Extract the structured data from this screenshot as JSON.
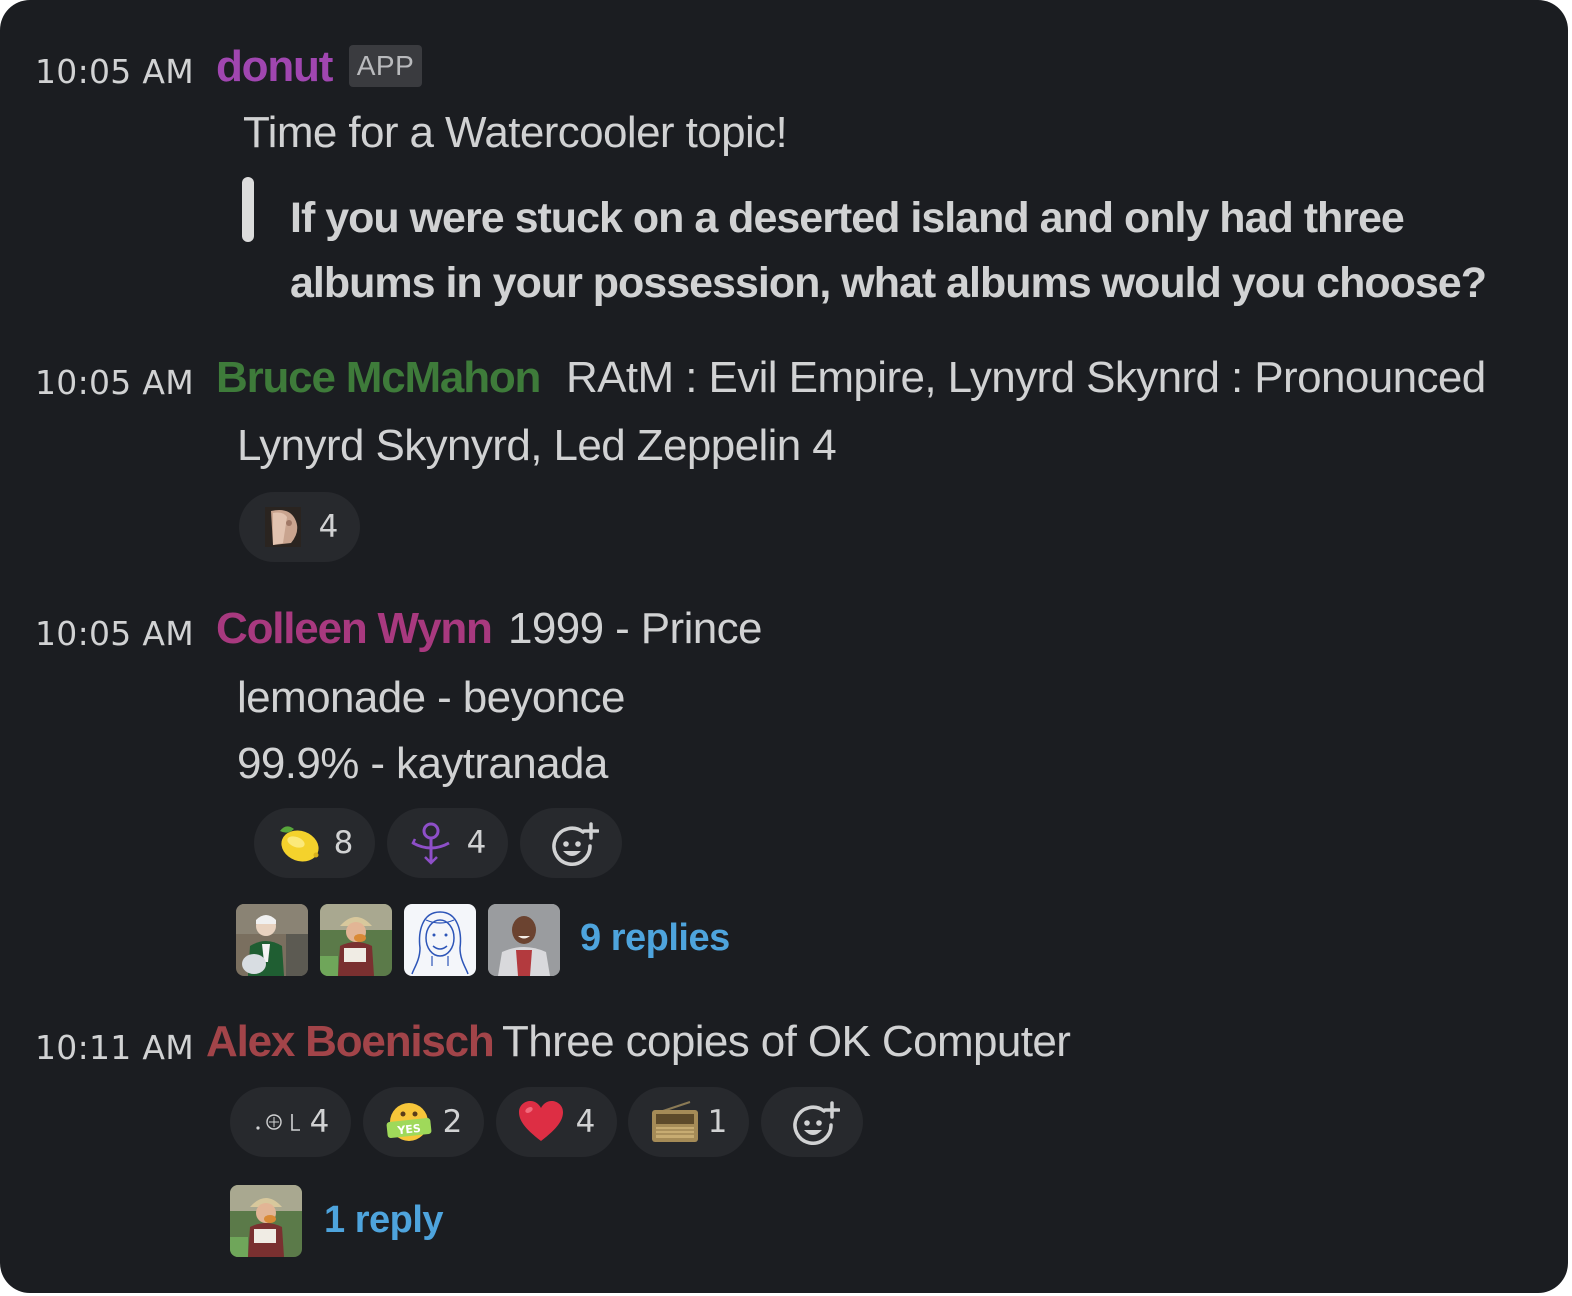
{
  "colors": {
    "background": "#1b1d21",
    "text": "#d1d2d3",
    "donut_name": "#a046b0",
    "bruce_name": "#3e7b3a",
    "colleen_name": "#a8397f",
    "alex_name": "#a24449",
    "link": "#4ea4dd",
    "reaction_bg": "#27292d"
  },
  "messages": [
    {
      "time": "10:05 AM",
      "author": "donut",
      "badge": "APP",
      "lines": [
        "Time for a Watercooler topic!"
      ],
      "quote": "If you were stuck on a deserted island and only had three albums in your possession, what albums would you choose?"
    },
    {
      "time": "10:05 AM",
      "author": "Bruce McMahon",
      "lines": [
        "RAtM : Evil Empire, Lynyrd Skynrd : Pronounced",
        "Lynyrd Skynyrd, Led Zeppelin 4"
      ],
      "reactions": [
        {
          "icon": "face-avatar-emoji",
          "count": "4"
        }
      ]
    },
    {
      "time": "10:05 AM",
      "author": "Colleen Wynn",
      "lines": [
        "1999 - Prince",
        "lemonade - beyonce",
        "99.9% - kaytranada"
      ],
      "reactions": [
        {
          "icon": "lemon-emoji",
          "count": "8"
        },
        {
          "icon": "prince-symbol-emoji",
          "count": "4"
        },
        {
          "icon": "add-reaction-icon",
          "count": ""
        }
      ],
      "thread": {
        "replies": "9 replies"
      }
    },
    {
      "time": "10:11 AM",
      "author": "Alex Boenisch",
      "lines": [
        "Three copies of OK Computer"
      ],
      "reactions": [
        {
          "icon": "ok-computer-emoji",
          "count": "4"
        },
        {
          "icon": "yes-sign-emoji",
          "count": "2"
        },
        {
          "icon": "heart-emoji",
          "count": "4"
        },
        {
          "icon": "radio-emoji",
          "count": "1"
        },
        {
          "icon": "add-reaction-icon",
          "count": ""
        }
      ],
      "thread": {
        "replies": "1 reply"
      }
    }
  ]
}
